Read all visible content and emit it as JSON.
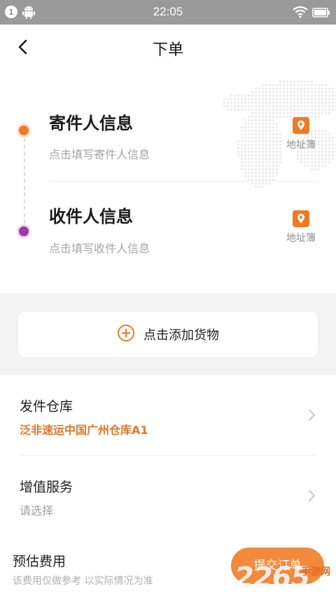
{
  "status_bar": {
    "notification_count": "1",
    "time": "22:05",
    "icons": [
      "android-icon",
      "wifi-icon",
      "battery-icon"
    ]
  },
  "nav": {
    "title": "下单",
    "back_icon": "back-arrow-icon"
  },
  "sender": {
    "title": "寄件人信息",
    "hint": "点击填写寄件人信息",
    "address_book_label": "地址簿"
  },
  "receiver": {
    "title": "收件人信息",
    "hint": "点击填写收件人信息",
    "address_book_label": "地址簿"
  },
  "goods": {
    "add_label": "点击添加货物",
    "icon": "add-circle-icon"
  },
  "warehouse": {
    "title": "发件仓库",
    "value": "泛非速运中国广州仓库A1"
  },
  "value_added": {
    "title": "增值服务",
    "value": "请选择"
  },
  "footer": {
    "fee_label": "预估费用",
    "fee_note": "该费用仅做参考 以实际情况为准",
    "submit_label": "提交订单"
  },
  "watermark": {
    "big": "2265",
    "small": "手游网"
  },
  "colors": {
    "accent": "#f07a23",
    "receiver_dot": "#9b3aa6",
    "status_bar": "#9a9a9a",
    "background": "#f4f3f3"
  }
}
